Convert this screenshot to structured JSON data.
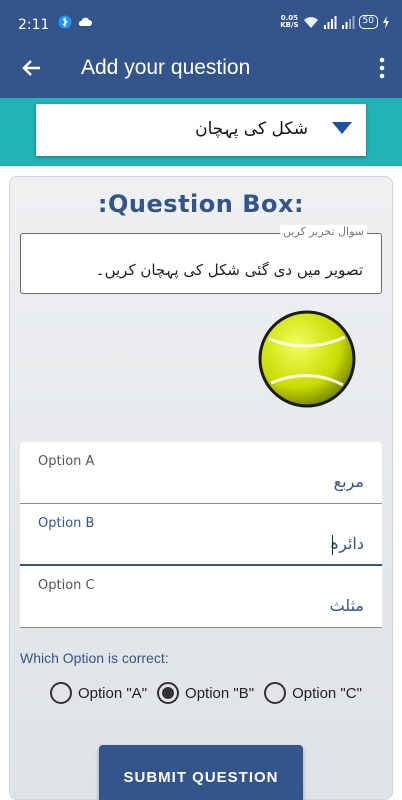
{
  "status_bar": {
    "time": "2:11",
    "network_speed": "0.05",
    "network_unit": "KB/S",
    "signal_label": "4G",
    "battery": "50"
  },
  "app_bar": {
    "title": "Add your question",
    "back_icon": "arrow-left-icon",
    "more_icon": "more-vert-icon"
  },
  "category_dropdown": {
    "selected": "شکل کی پہچان"
  },
  "question_box": {
    "heading": ":Question Box:",
    "question_label": "سوال تحریر کریں",
    "question_text": "تصویر میں دی گئی شکل کی پہچان کریں۔"
  },
  "options": [
    {
      "label": "Option A",
      "value": "مربع"
    },
    {
      "label": "Option B",
      "value": "دائرہ"
    },
    {
      "label": "Option C",
      "value": "مثلث"
    }
  ],
  "correct_option": {
    "prompt": "Which Option is correct:",
    "choices": [
      "Option \"A\"",
      "Option \"B\"",
      "Option \"C\""
    ],
    "selected": "Option \"B\""
  },
  "submit_label": "SUBMIT QUESTION",
  "colors": {
    "primary": "#34558b",
    "teal": "#21b3b5",
    "ball": "#c8dc00"
  }
}
